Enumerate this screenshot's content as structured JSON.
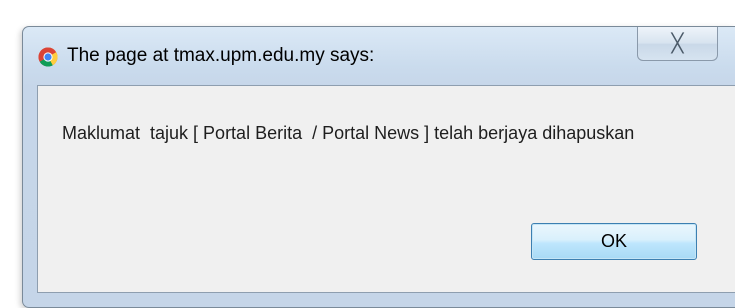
{
  "dialog": {
    "title": "The page at tmax.upm.edu.my says:",
    "title_icon": "chrome-icon",
    "close_glyph": "╳",
    "close_icon": "close-icon",
    "message": "Maklumat  tajuk [ Portal Berita  / Portal News ] telah berjaya dihapuskan",
    "ok_label": "OK"
  }
}
